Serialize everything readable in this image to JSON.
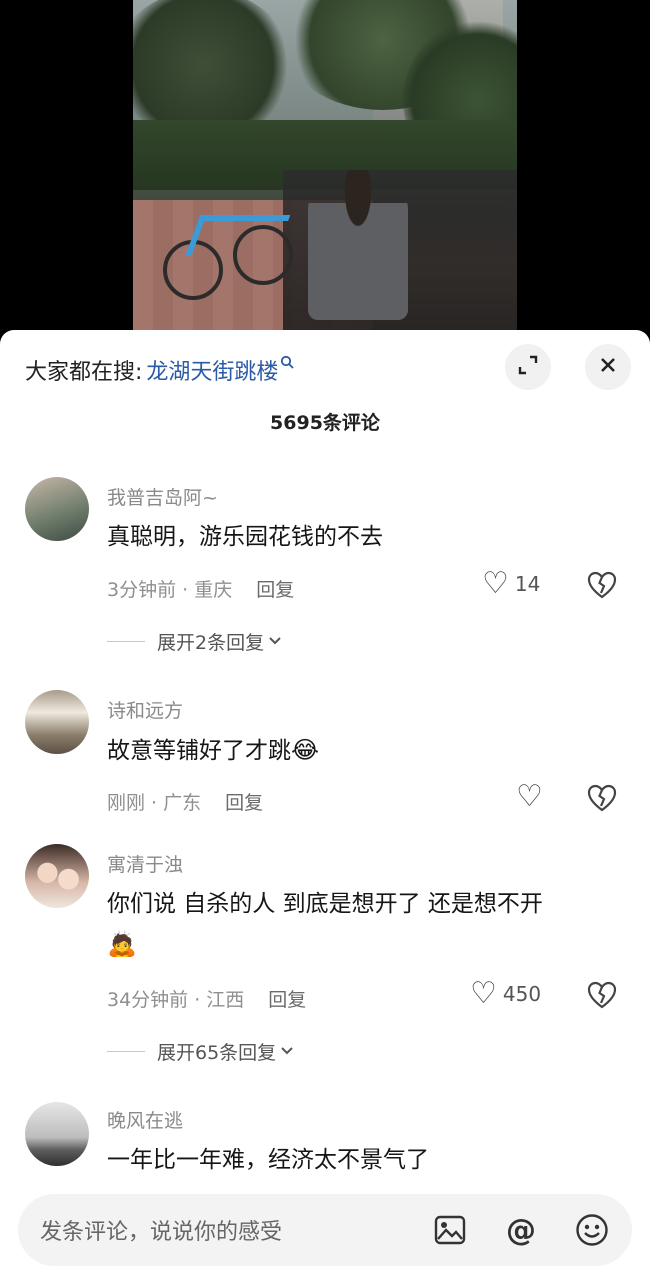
{
  "search": {
    "prefix": "大家都在搜:",
    "term": "龙湖天街跳楼",
    "icon": "magnifier-icon"
  },
  "header": {
    "comment_count": "5695条评论"
  },
  "comments": [
    {
      "username": "我普吉岛阿~",
      "text": "真聪明，游乐园花钱的不去",
      "time": "3分钟前 · 重庆",
      "reply": "回复",
      "likes": "14",
      "expand": "展开2条回复"
    },
    {
      "username": "诗和远方",
      "text": "故意等铺好了才跳",
      "emoji": "😂",
      "time": "刚刚 · 广东",
      "reply": "回复",
      "likes": ""
    },
    {
      "username": "寓清于浊",
      "text": "你们说 自杀的人 到底是想开了 还是想不开",
      "emoji": "🙇",
      "time": "34分钟前 · 江西",
      "reply": "回复",
      "likes": "450",
      "expand": "展开65条回复"
    },
    {
      "username": "晚风在逃",
      "text": "一年比一年难，经济太不景气了"
    }
  ],
  "input": {
    "placeholder": "发条评论，说说你的感受"
  },
  "colors": {
    "link_blue": "#2a5aa8",
    "muted_gray": "#8a8a8a"
  }
}
